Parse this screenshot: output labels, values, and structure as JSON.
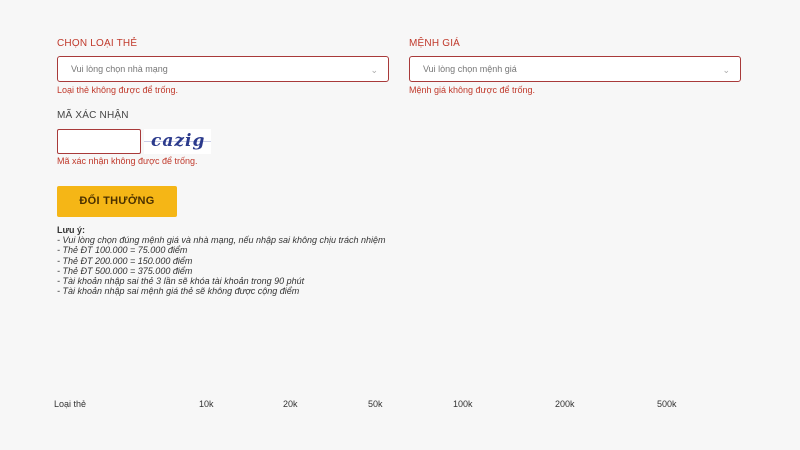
{
  "form": {
    "card_type": {
      "label": "CHỌN LOẠI THẺ",
      "placeholder": "Vui lòng chọn nhà mạng",
      "error": "Loại thẻ không được để trống."
    },
    "denomination": {
      "label": "MỆNH GIÁ",
      "placeholder": "Vui lòng chọn mệnh giá",
      "error": "Mệnh giá không được để trống."
    },
    "captcha": {
      "label": "MÃ XÁC NHẬN",
      "value": "",
      "image_text": "cazig",
      "error": "Mã xác nhận không được để trống."
    },
    "submit_label": "ĐỔI THƯỞNG"
  },
  "notes": {
    "title": "Lưu ý:",
    "lines": [
      "- Vui lòng chọn đúng mệnh giá và nhà mạng, nếu nhập sai không chịu trách nhiệm",
      "- Thẻ ĐT 100.000 = 75.000 điểm",
      "- Thẻ ĐT 200.000 = 150.000 điểm",
      "- Thẻ ĐT 500.000 = 375.000 điểm",
      "- Tài khoản nhập sai thẻ 3 lần sẽ khóa tài khoản trong 90 phút",
      "- Tài khoản nhập sai mệnh giá thẻ sẽ không được cộng điểm"
    ]
  },
  "table": {
    "headers": [
      "Loại thẻ",
      "10k",
      "20k",
      "50k",
      "100k",
      "200k",
      "500k"
    ]
  },
  "colors": {
    "error": "#c0392b",
    "border": "#a83a3a",
    "button": "#f5b616",
    "background": "#f7f7f7"
  },
  "icons": {
    "dropdown": "chevron-down-icon"
  }
}
